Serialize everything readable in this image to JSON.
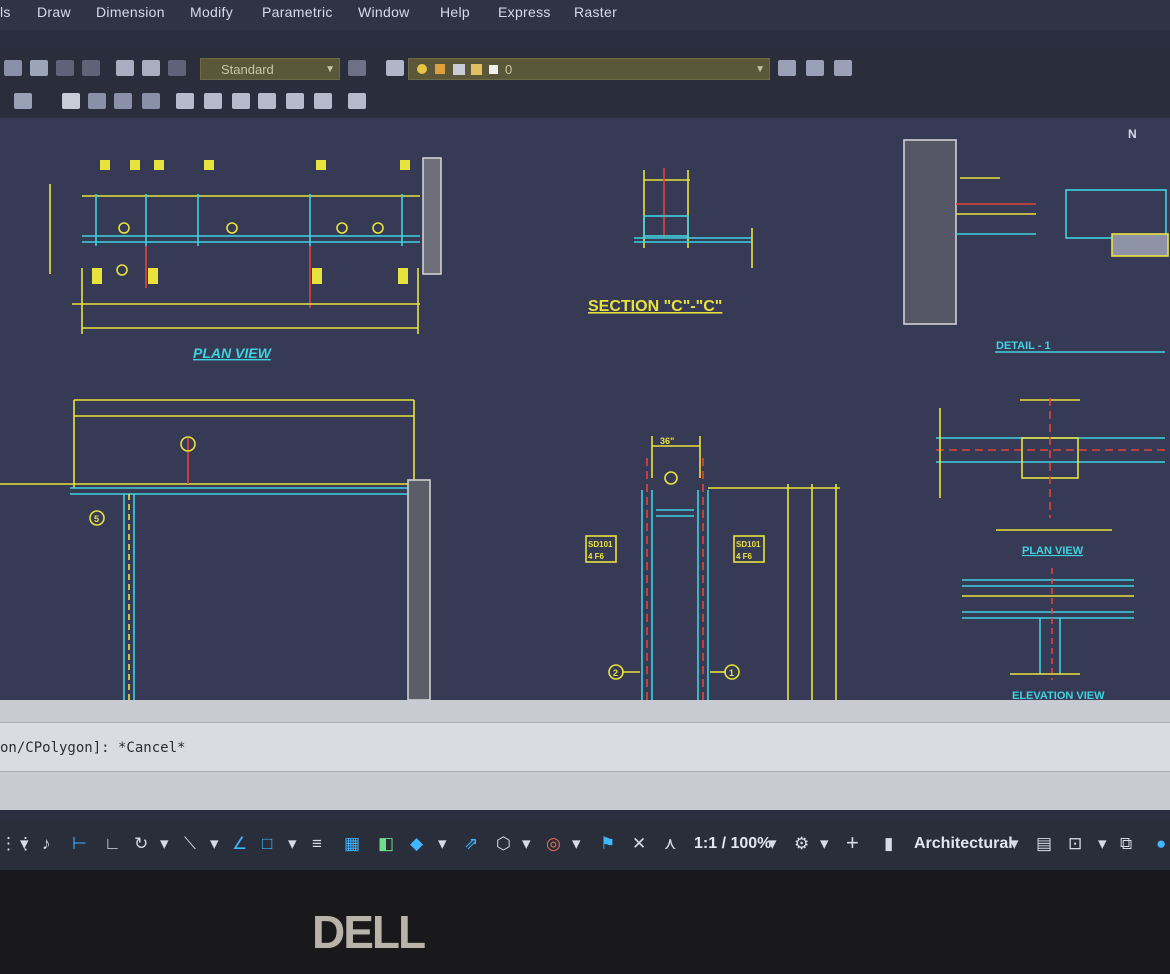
{
  "menu": {
    "items": [
      "ls",
      "Draw",
      "Dimension",
      "Modify",
      "Parametric",
      "Window",
      "Help",
      "Express",
      "Raster"
    ]
  },
  "toolbar": {
    "text_style": "Standard",
    "layer_value": "0"
  },
  "drawing": {
    "plan_view_title": "PLAN VIEW",
    "section_title": "SECTION \"C\"-\"C\"",
    "detail_title": "DETAIL - 1",
    "small_plan_title": "PLAN VIEW",
    "elevation_title": "ELEVATION VIEW",
    "north_label": "N",
    "tag_sd_left": "SD101",
    "tag_sd_left_2": "4 F6",
    "tag_sd_right": "SD101",
    "tag_sd_right_2": "4 F6",
    "gridline_2": "2",
    "gridline_1": "1",
    "gridline_5": "5",
    "dim_36": "36\""
  },
  "command": {
    "text": "on/CPolygon]: *Cancel*"
  },
  "status": {
    "scale": "1:1 / 100%",
    "units": "Architectural"
  },
  "bezel": {
    "brand": "DELL"
  },
  "colors": {
    "background": "#363a55",
    "yellow": "#e8e23c",
    "cyan": "#3fd3e0",
    "red": "#e0443a"
  }
}
